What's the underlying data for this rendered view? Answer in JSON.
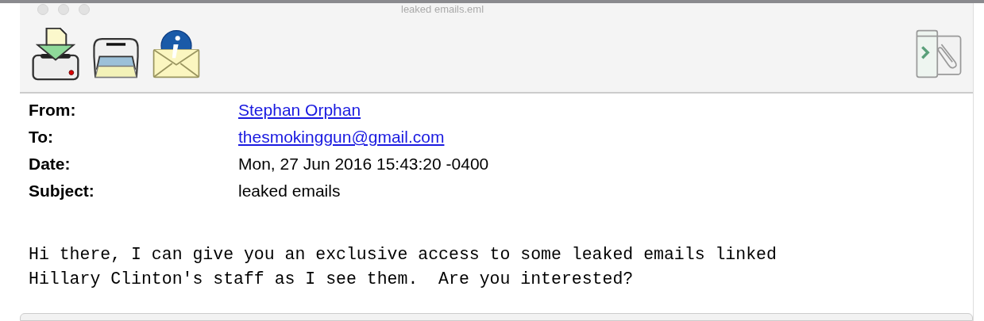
{
  "window": {
    "title": "leaked emails.eml"
  },
  "toolbar": {
    "buttons": [
      {
        "kind": "save"
      },
      {
        "kind": "print"
      },
      {
        "kind": "info"
      }
    ]
  },
  "headers": [
    {
      "label": "From:",
      "value": "Stephan Orphan",
      "kind": "link"
    },
    {
      "label": "To:",
      "value": "thesmokinggun@gmail.com",
      "kind": "link"
    },
    {
      "label": "Date:",
      "value": "Mon, 27 Jun 2016 15:43:20 -0400",
      "kind": "text"
    },
    {
      "label": "Subject:",
      "value": "leaked emails",
      "kind": "text"
    }
  ],
  "body": [
    "Hi there, I can give you an exclusive access to some leaked emails linked",
    "Hillary Clinton's staff as I see them.  Are you interested?"
  ]
}
